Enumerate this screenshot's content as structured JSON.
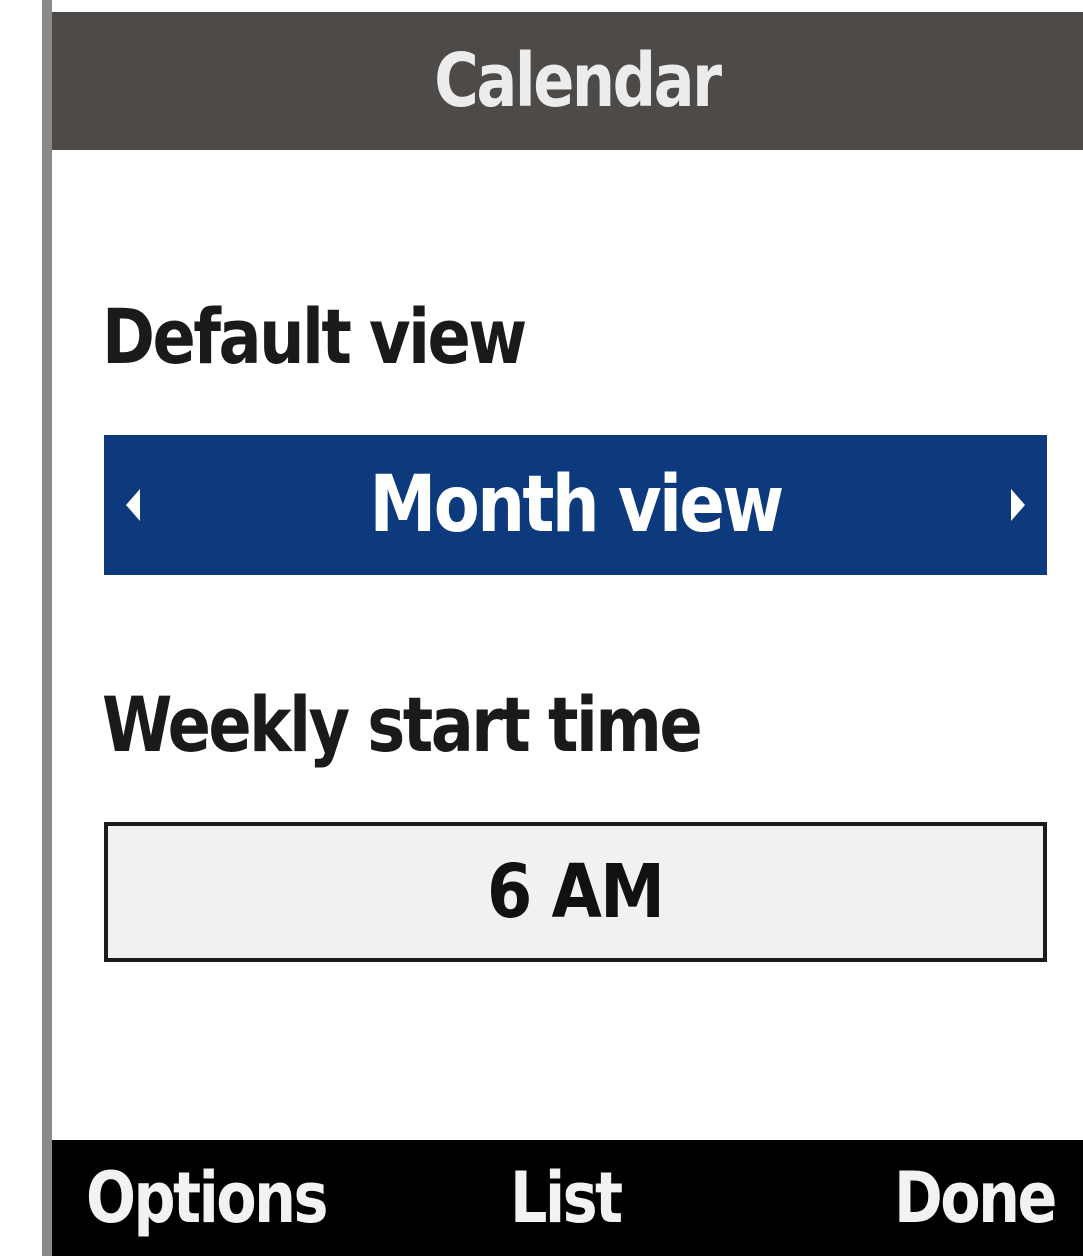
{
  "header": {
    "title": "Calendar"
  },
  "settings": {
    "default_view": {
      "label": "Default view",
      "value": "Month view"
    },
    "weekly_start_time": {
      "label": "Weekly start time",
      "value": "6 AM"
    }
  },
  "softkeys": {
    "left": "Options",
    "center": "List",
    "right": "Done"
  },
  "colors": {
    "title_bar": "#4d4a48",
    "selected_field": "#0d3a7d",
    "softkey_bar": "#000000"
  }
}
